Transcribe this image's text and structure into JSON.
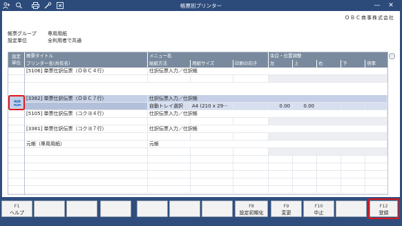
{
  "window": {
    "title": "帳票別プリンター",
    "company": "ＯＢＣ商事株式会社"
  },
  "toolbar_icons": [
    "add-user-icon",
    "zoom-icon",
    "print-icon",
    "settings-icon",
    "export-icon"
  ],
  "info": {
    "group_label": "帳票グループ",
    "group_value": "専用用紙",
    "unit_label": "設定単位",
    "unit_value": "全利用者で共通"
  },
  "grid": {
    "headers_row1": {
      "unit": "設定\n単位",
      "form_title": "帳票タイトル",
      "menu_name": "メニュー名",
      "margin": "余白・位置調整"
    },
    "headers_row2": {
      "printer": "プリンター名(共有名)",
      "feed": "給紙方法",
      "paper": "用紙サイズ",
      "orientation": "印刷の向き",
      "left": "左",
      "top": "上",
      "right": "右",
      "bottom": "下",
      "scale": "倍率"
    },
    "rows": [
      {
        "title": "[5106] 単票仕訳伝票（ＯＢＣ４行）",
        "menu": "仕訳伝票入力／仕訳帳",
        "printer": "",
        "feed": "",
        "paper": "",
        "orientation": "",
        "left": "",
        "top": ""
      },
      {
        "title": "[3382] 単票仕訳伝票（ＯＢＣ７行）",
        "menu": "仕訳伝票入力／仕訳帳",
        "printer": "",
        "feed": "自動トレイ選択",
        "paper": "A4 (210 x 29···",
        "orientation": "",
        "left": "0.00",
        "top": "0.00"
      },
      {
        "title": "[5105] 単票仕訳伝票（コクヨ４行）",
        "menu": "仕訳伝票入力／仕訳帳",
        "printer": "",
        "feed": "",
        "paper": "",
        "orientation": "",
        "left": "",
        "top": ""
      },
      {
        "title": "[3381] 単票仕訳伝票（コクヨ７行）",
        "menu": "仕訳伝票入力／仕訳帳",
        "printer": "",
        "feed": "",
        "paper": "",
        "orientation": "",
        "left": "",
        "top": ""
      },
      {
        "title": "元帳（専用用紙）",
        "menu": "元帳",
        "printer": "",
        "feed": "",
        "paper": "",
        "orientation": "",
        "left": "",
        "top": ""
      }
    ]
  },
  "fkeys": [
    {
      "fn": "F1",
      "label": "ヘルプ"
    },
    {
      "fn": "",
      "label": ""
    },
    {
      "fn": "",
      "label": ""
    },
    {
      "fn": "",
      "label": ""
    },
    {
      "fn": "",
      "label": ""
    },
    {
      "fn": "",
      "label": ""
    },
    {
      "fn": "",
      "label": ""
    },
    {
      "fn": "F8",
      "label": "設定初期化"
    },
    {
      "fn": "F9",
      "label": "変更"
    },
    {
      "fn": "F10",
      "label": "中止"
    },
    {
      "fn": "",
      "label": ""
    },
    {
      "fn": "F12",
      "label": "登録"
    }
  ],
  "colors": {
    "titlebar": "#2c4b7b",
    "header": "#7a8a9e",
    "selected_row": "#c5d0e6",
    "highlight_ring": "#e0161c"
  }
}
